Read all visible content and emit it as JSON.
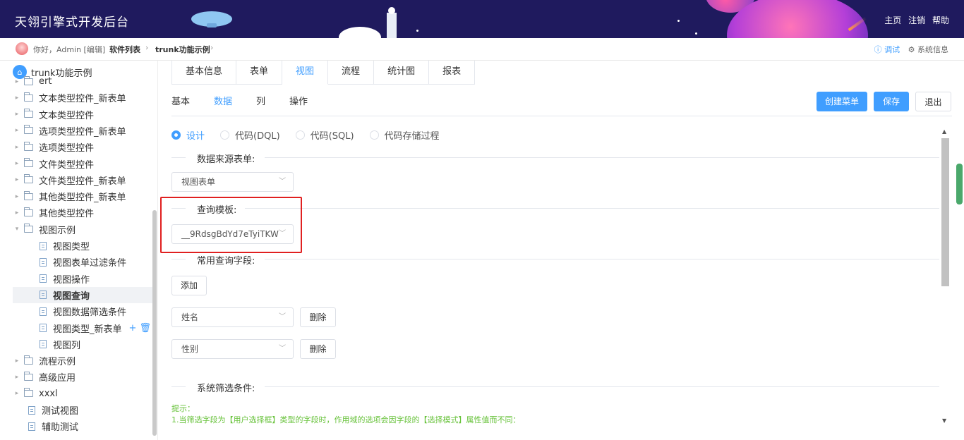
{
  "header": {
    "title": "天翎引擎式开发后台",
    "links": [
      "主页",
      "注销",
      "帮助"
    ]
  },
  "crumbbar": {
    "greeting": "你好，Admin [编辑]",
    "breadcrumb": [
      "软件列表",
      "trunk功能示例"
    ],
    "sep": "›",
    "debug": "ⓘ 调试",
    "sys_info": "⚙ 系统信息"
  },
  "sidebar": {
    "root": "trunk功能示例",
    "items": [
      {
        "label": "ert",
        "type": "folder",
        "indent": 0
      },
      {
        "label": "文本类型控件_新表单",
        "type": "folder",
        "indent": 0
      },
      {
        "label": "文本类型控件",
        "type": "folder",
        "indent": 0
      },
      {
        "label": "选项类型控件_新表单",
        "type": "folder",
        "indent": 0
      },
      {
        "label": "选项类型控件",
        "type": "folder",
        "indent": 0
      },
      {
        "label": "文件类型控件",
        "type": "folder",
        "indent": 0
      },
      {
        "label": "文件类型控件_新表单",
        "type": "folder",
        "indent": 0
      },
      {
        "label": "其他类型控件_新表单",
        "type": "folder",
        "indent": 0
      },
      {
        "label": "其他类型控件",
        "type": "folder",
        "indent": 0
      },
      {
        "label": "视图示例",
        "type": "folder-open",
        "indent": 0
      },
      {
        "label": "视图类型",
        "type": "doc",
        "indent": 1
      },
      {
        "label": "视图表单过滤条件",
        "type": "doc",
        "indent": 1
      },
      {
        "label": "视图操作",
        "type": "doc",
        "indent": 1
      },
      {
        "label": "视图查询",
        "type": "doc",
        "indent": 1,
        "active": true
      },
      {
        "label": "视图数据筛选条件",
        "type": "doc",
        "indent": 1
      },
      {
        "label": "视图类型_新表单",
        "type": "doc",
        "indent": 1,
        "actions": "+ 🗑"
      },
      {
        "label": "视图列",
        "type": "doc",
        "indent": 1
      },
      {
        "label": "流程示例",
        "type": "folder",
        "indent": 0
      },
      {
        "label": "高级应用",
        "type": "folder",
        "indent": 0
      },
      {
        "label": "xxxl",
        "type": "folder",
        "indent": 0
      },
      {
        "label": "测试视图",
        "type": "doc",
        "indent": 0
      },
      {
        "label": "辅助测试",
        "type": "doc",
        "indent": 0
      }
    ]
  },
  "main": {
    "tabs": [
      "基本信息",
      "表单",
      "视图",
      "流程",
      "统计图",
      "报表"
    ],
    "active_tab": "视图",
    "subtabs": [
      "基本",
      "数据",
      "列",
      "操作"
    ],
    "active_subtab": "数据",
    "buttons": {
      "create_menu": "创建菜单",
      "save": "保存",
      "exit": "退出"
    },
    "radios": [
      {
        "label": "设计",
        "checked": true
      },
      {
        "label": "代码(DQL)",
        "checked": false
      },
      {
        "label": "代码(SQL)",
        "checked": false
      },
      {
        "label": "代码存储过程",
        "checked": false
      }
    ],
    "datasource": {
      "label": "数据来源表单:",
      "value": "视图表单"
    },
    "query_template": {
      "label": "查询模板:",
      "value": "__9RdsgBdYd7eTyiTKW"
    },
    "common_fields": {
      "label": "常用查询字段:",
      "add": "添加",
      "fields": [
        {
          "value": "姓名",
          "delete": "删除"
        },
        {
          "value": "性别",
          "delete": "删除"
        }
      ]
    },
    "filter": {
      "label": "系统筛选条件:",
      "hint_title": "提示：",
      "hint_line1": "1.当筛选字段为【用户选择框】类型的字段时，作用域的选项会因字段的【选择模式】属性值而不同："
    }
  },
  "colors": {
    "accent": "#409eff",
    "header_bg": "#1f1a5e",
    "hint": "#67c23a",
    "highlight": "#e02020"
  }
}
